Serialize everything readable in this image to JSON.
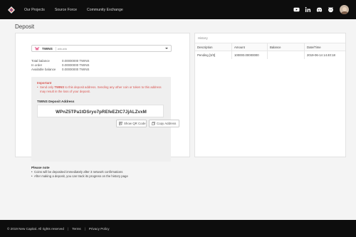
{
  "navbar": {
    "links": [
      "Our Projects",
      "Source Force",
      "Community Exchange"
    ],
    "social_icons": [
      "youtube-icon",
      "linkedin-icon",
      "discord-icon",
      "github-icon"
    ]
  },
  "page": {
    "title": "Deposit"
  },
  "deposit": {
    "coin_ticker": "TWINS",
    "coin_name": "win.win",
    "balances": [
      {
        "label": "Total balance",
        "value": "0.00000000 TWINS"
      },
      {
        "label": "In order",
        "value": "0.00000000 TWINS"
      },
      {
        "label": "Available balance",
        "value": "0.00000000 TWINS"
      }
    ],
    "important_title": "Important",
    "warning_text": "Send only TWINS to this deposit address. Sending any other coin or token to this address may result in the loss of your deposit.",
    "address_label": "TWINS Deposit Address",
    "address": "WPnZ5TPa1tDSryo7pREfeEZtC7JjALZvxM",
    "qr_button": "Show QR Code",
    "copy_button": "Copy Address",
    "note_title": "Please note",
    "notes": [
      "Coins will be deposited immediately after 3 network confirmations",
      "After making a deposit, you can track its progress on the history page"
    ]
  },
  "history": {
    "title": "History",
    "columns": [
      "Description",
      "Amount",
      "Balance",
      "Date/Time"
    ],
    "rows": [
      [
        "Pending [3/3]",
        "100000.00000000",
        "",
        "2019-06-14 14:40:18"
      ]
    ]
  },
  "footer": {
    "copyright": "© 2019 New Capital. All rights reserved",
    "links": [
      "Terms",
      "Privacy Policy"
    ]
  },
  "colors": {
    "navbar": "#0d0d0d",
    "warning": "#d9534f",
    "page_bg": "#f4f4f4"
  }
}
